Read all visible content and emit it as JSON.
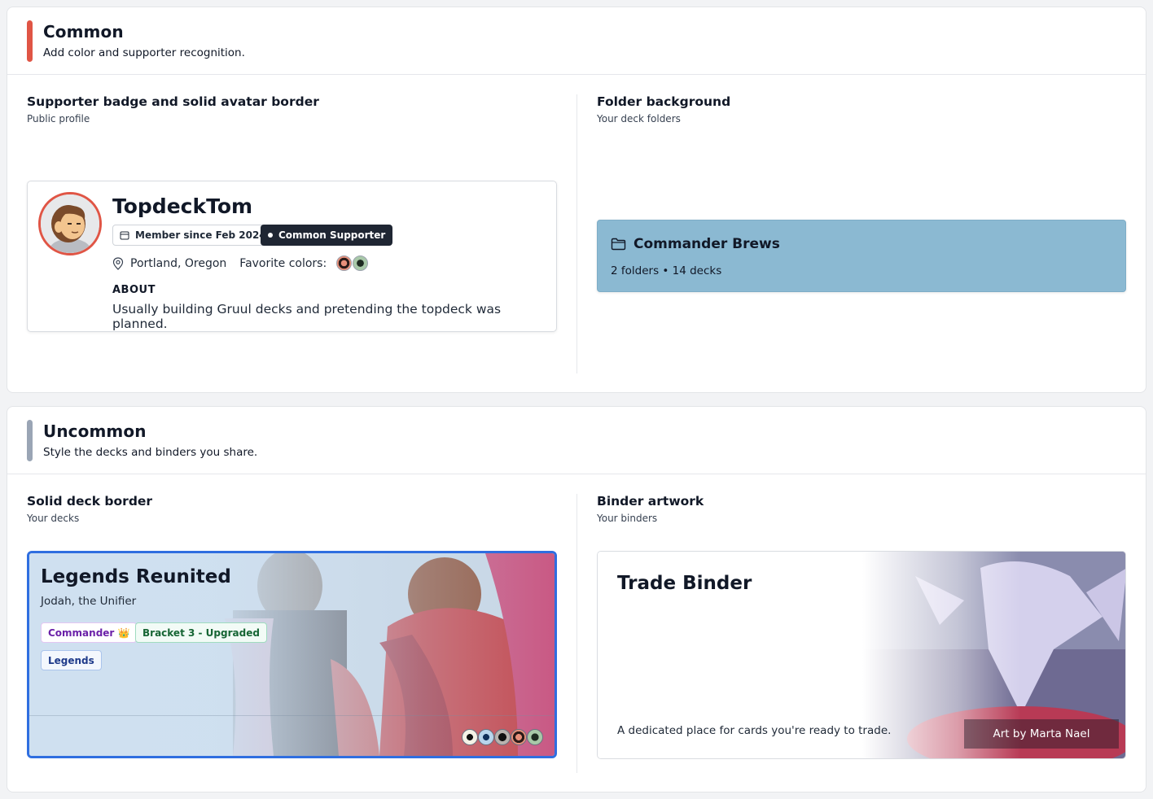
{
  "colors": {
    "common_accent": "#e05545",
    "uncommon_accent": "#9aa5b5",
    "supporter_badge_bg": "#1f2633",
    "folder_bg": "#8bb9d2",
    "deck_border": "#2f6ee0"
  },
  "common": {
    "title": "Common",
    "subtitle": "Add color and supporter recognition.",
    "profile_feature": {
      "title": "Supporter badge and solid avatar border",
      "subtitle": "Public profile",
      "profile": {
        "username": "TopdeckTom",
        "member_since": "Member since Feb 2024",
        "supporter_badge": "Common Supporter",
        "location": "Portland, Oregon",
        "favorite_colors_label": "Favorite colors:",
        "favorite_colors": [
          "red",
          "green"
        ],
        "about_label": "ABOUT",
        "about_text": "Usually building Gruul decks and pretending the topdeck was planned."
      }
    },
    "folder_feature": {
      "title": "Folder background",
      "subtitle": "Your deck folders",
      "folder": {
        "name": "Commander Brews",
        "meta": "2 folders • 14 decks"
      }
    }
  },
  "uncommon": {
    "title": "Uncommon",
    "subtitle": "Style the decks and binders you share.",
    "deck_feature": {
      "title": "Solid deck border",
      "subtitle": "Your decks",
      "deck": {
        "name": "Legends Reunited",
        "commander": "Jodah, the Unifier",
        "tag_commander": "Commander 👑",
        "tag_bracket": "Bracket 3 - Upgraded",
        "tag_legends": "Legends",
        "mana": [
          "white",
          "blue",
          "black",
          "red",
          "green"
        ]
      }
    },
    "binder_feature": {
      "title": "Binder artwork",
      "subtitle": "Your binders",
      "binder": {
        "name": "Trade Binder",
        "description": "A dedicated place for cards you're ready to trade.",
        "art_credit": "Art by Marta Nael"
      }
    }
  }
}
